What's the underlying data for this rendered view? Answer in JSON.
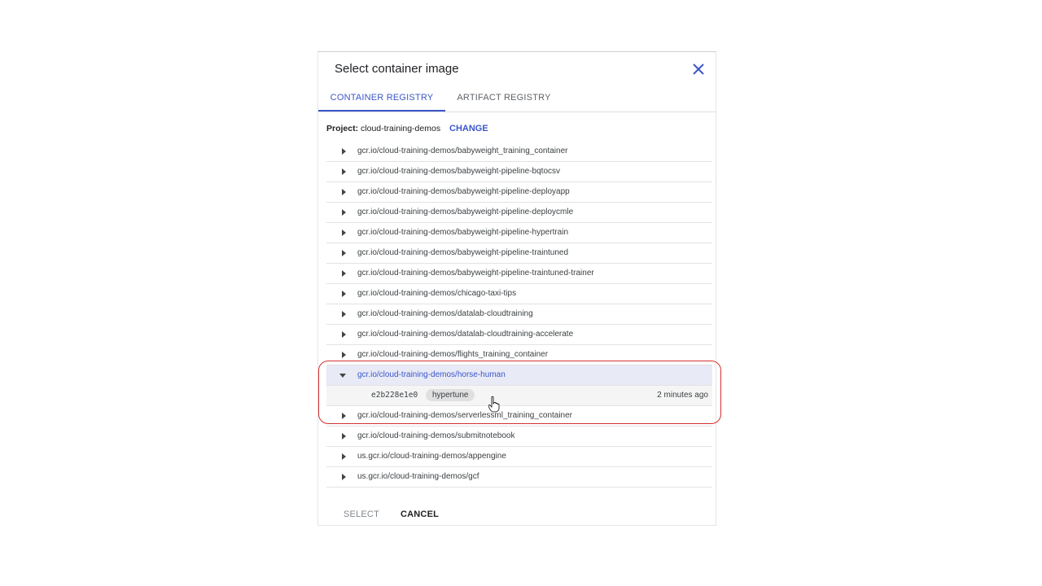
{
  "dialog": {
    "title": "Select container image",
    "close_icon": "close-icon",
    "accent_color": "#3c56c9",
    "tabs": [
      {
        "label": "CONTAINER REGISTRY",
        "active": true
      },
      {
        "label": "ARTIFACT REGISTRY",
        "active": false
      }
    ],
    "project": {
      "label": "Project:",
      "value": "cloud-training-demos",
      "change_label": "CHANGE"
    },
    "images": [
      {
        "path": "gcr.io/cloud-training-demos/babyweight_training_container"
      },
      {
        "path": "gcr.io/cloud-training-demos/babyweight-pipeline-bqtocsv"
      },
      {
        "path": "gcr.io/cloud-training-demos/babyweight-pipeline-deployapp"
      },
      {
        "path": "gcr.io/cloud-training-demos/babyweight-pipeline-deploycmle"
      },
      {
        "path": "gcr.io/cloud-training-demos/babyweight-pipeline-hypertrain"
      },
      {
        "path": "gcr.io/cloud-training-demos/babyweight-pipeline-traintuned"
      },
      {
        "path": "gcr.io/cloud-training-demos/babyweight-pipeline-traintuned-trainer"
      },
      {
        "path": "gcr.io/cloud-training-demos/chicago-taxi-tips"
      },
      {
        "path": "gcr.io/cloud-training-demos/datalab-cloudtraining"
      },
      {
        "path": "gcr.io/cloud-training-demos/datalab-cloudtraining-accelerate"
      },
      {
        "path": "gcr.io/cloud-training-demos/flights_training_container"
      },
      {
        "path": "gcr.io/cloud-training-demos/horse-human",
        "expanded": true,
        "version": {
          "digest": "e2b228e1e0",
          "tag": "hypertune",
          "age": "2 minutes ago"
        }
      },
      {
        "path": "gcr.io/cloud-training-demos/serverlessml_training_container"
      },
      {
        "path": "gcr.io/cloud-training-demos/submitnotebook"
      },
      {
        "path": "us.gcr.io/cloud-training-demos/appengine"
      },
      {
        "path": "us.gcr.io/cloud-training-demos/gcf"
      }
    ],
    "footer": {
      "select_label": "SELECT",
      "cancel_label": "CANCEL"
    },
    "highlight_color": "#d32f2f"
  }
}
